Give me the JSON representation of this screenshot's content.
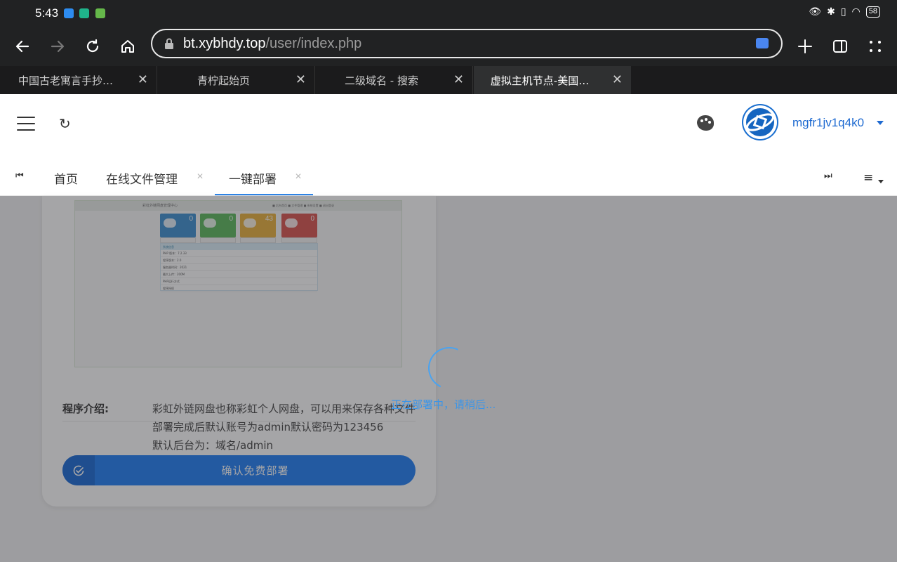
{
  "status_bar": {
    "time": "5:43",
    "battery": "58"
  },
  "browser": {
    "url_host": "bt.xybhdy.top",
    "url_path": "/user/index.php",
    "tabs": [
      {
        "title": "中国古老寓言手抄…"
      },
      {
        "title": "青柠起始页"
      },
      {
        "title": "二级域名 - 搜索"
      },
      {
        "title": "虚拟主机节点-美国…"
      }
    ]
  },
  "header": {
    "username": "mgfr1jv1q4k0"
  },
  "page_tabs": {
    "home": "首页",
    "file_manager": "在线文件管理",
    "one_click": "一键部署"
  },
  "preview": {
    "title": "彩虹外链网盘管理中心",
    "nav": "■ 后台首页  ■ 文件管理  ■ 系统设置  ■ 退出登录",
    "stats": [
      {
        "value": "0",
        "color": "#3d8fd1"
      },
      {
        "value": "0",
        "color": "#5cb85c"
      },
      {
        "value": "43",
        "color": "#e9b03c"
      },
      {
        "value": "0",
        "color": "#d9534f"
      }
    ],
    "panel_head": "系统信息",
    "panel_rows": [
      "PHP 版本：7.2.33",
      "程序版本：2.0",
      "服务器时间：2021",
      "最大上传：200M",
      "PHP运行方式",
      "程序授权"
    ]
  },
  "intro": {
    "label": "程序介绍:",
    "lines": [
      "彩虹外链网盘也称彩虹个人网盘，可以用来保存各种文件",
      "部署完成后默认账号为admin默认密码为123456",
      "默认后台为：域名/admin"
    ]
  },
  "deploy_button": "确认免费部署",
  "loading_text": "正在部署中，请稍后..."
}
